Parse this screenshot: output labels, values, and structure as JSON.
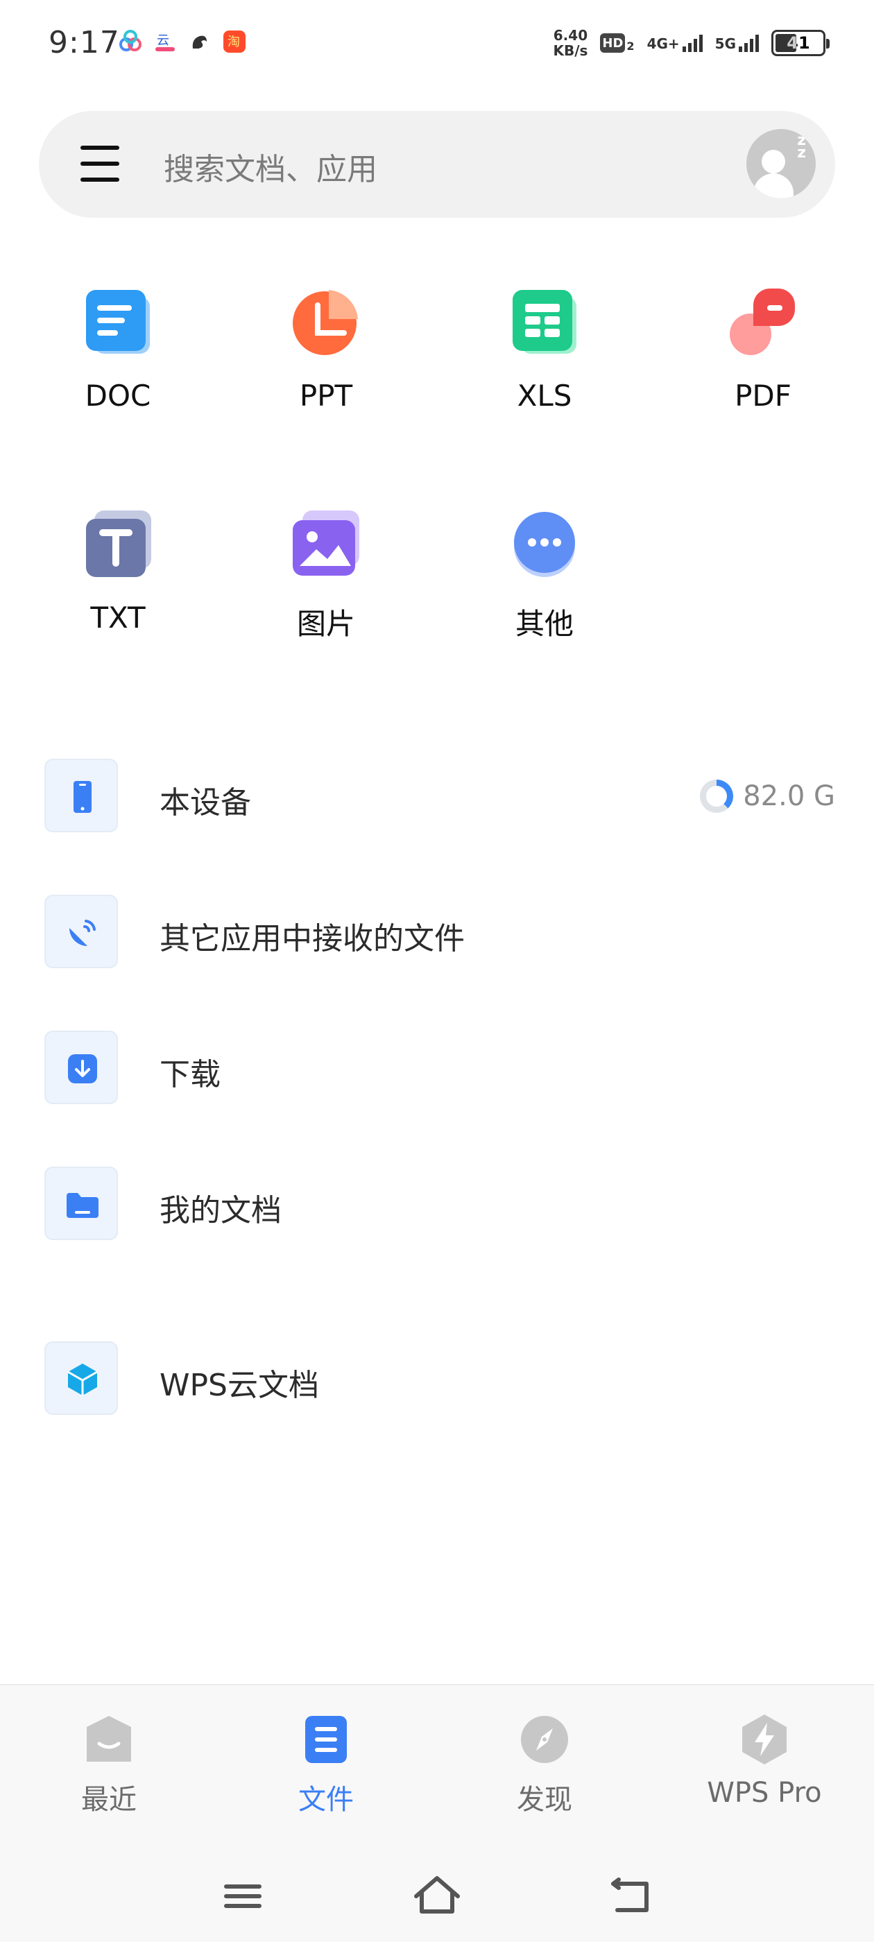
{
  "status_bar": {
    "time": "9:17",
    "net_speed_value": "6.40",
    "net_speed_unit": "KB/s",
    "hd_label": "HD",
    "hd_sub": "2",
    "network_1": "4G+",
    "network_2": "5G",
    "battery": "41"
  },
  "search": {
    "placeholder": "搜索文档、应用"
  },
  "categories": [
    {
      "label": "DOC",
      "icon": "doc-icon",
      "color": "#2e9bf5"
    },
    {
      "label": "PPT",
      "icon": "ppt-icon",
      "color": "#ff6b3d"
    },
    {
      "label": "XLS",
      "icon": "xls-icon",
      "color": "#1ecb8a"
    },
    {
      "label": "PDF",
      "icon": "pdf-icon",
      "color": "#f24b4b"
    },
    {
      "label": "TXT",
      "icon": "txt-icon",
      "color": "#6b77a8"
    },
    {
      "label": "图片",
      "icon": "image-icon",
      "color": "#8a62f0"
    },
    {
      "label": "其他",
      "icon": "more-icon",
      "color": "#5f8ef5"
    }
  ],
  "locations": [
    {
      "label": "本设备",
      "icon": "phone-icon",
      "storage": "82.0 G"
    },
    {
      "label": "其它应用中接收的文件",
      "icon": "satellite-icon"
    },
    {
      "label": "下载",
      "icon": "download-icon"
    },
    {
      "label": "我的文档",
      "icon": "folder-icon"
    },
    {
      "label": "WPS云文档",
      "icon": "cloud-cube-icon"
    }
  ],
  "bottom_nav": {
    "tabs": [
      {
        "label": "最近",
        "icon": "recent-icon",
        "active": false
      },
      {
        "label": "文件",
        "icon": "file-icon",
        "active": true
      },
      {
        "label": "发现",
        "icon": "compass-icon",
        "active": false
      },
      {
        "label": "WPS Pro",
        "icon": "bolt-icon",
        "active": false
      }
    ]
  },
  "colors": {
    "accent": "#3b7ff5",
    "inactive": "#6b6b6b"
  }
}
